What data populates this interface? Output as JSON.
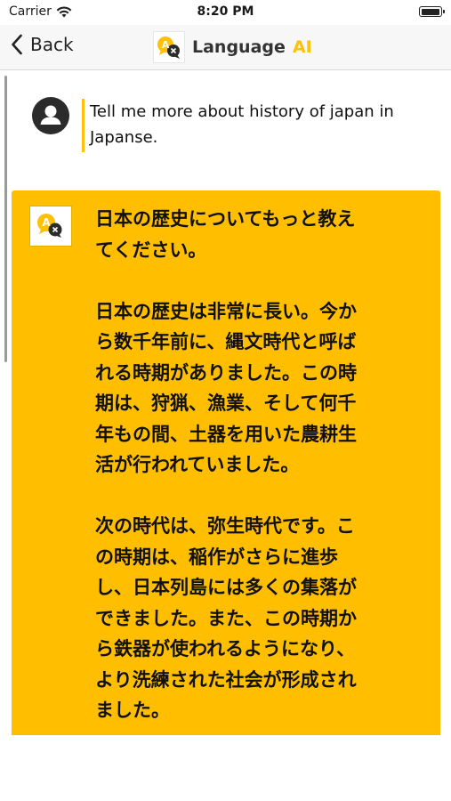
{
  "status_bar": {
    "carrier": "Carrier",
    "time": "8:20 PM",
    "battery_level": 1.0
  },
  "nav": {
    "back_label": "Back",
    "title_main": "Language",
    "title_accent": "AI",
    "logo_text": "A"
  },
  "messages": {
    "user": {
      "text": "Tell me more about history of japan in Japanse."
    },
    "ai": {
      "paragraphs": [
        "日本の歴史についてもっと教え\nてください。",
        "日本の歴史は非常に長い。今か\nら数千年前に、縄文時代と呼ば\nれる時期がありました。この時\n期は、狩猟、漁業、そして何千\n年もの間、土器を用いた農耕生\n活が行われていました。",
        "次の時代は、弥生時代です。こ\nの時期は、稲作がさらに進歩\nし、日本列島には多くの集落が\nできました。また、この時期か\nら鉄器が使われるようになり、\nより洗練された社会が形成され\nました。"
      ]
    }
  },
  "colors": {
    "accent": "#ffc107",
    "ai_bubble": "#ffbf00",
    "avatar": "#2b2b2b"
  },
  "icons": {
    "back": "chevron-left-icon",
    "wifi": "wifi-icon",
    "user": "person-icon",
    "logo": "translate-icon"
  }
}
